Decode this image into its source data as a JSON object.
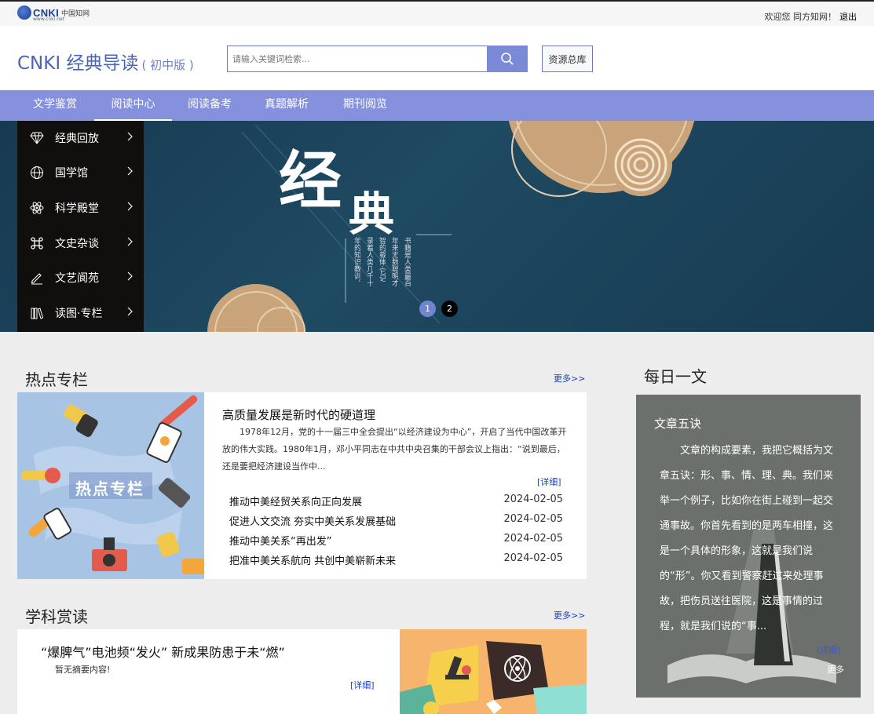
{
  "topbar": {
    "logo_text": "CNKI",
    "logo_cn": "中国知网",
    "logo_url": "www.cnki.net",
    "welcome": "欢迎您 同方知网！",
    "logout": "退出"
  },
  "header": {
    "brand": "CNKI 经典导读",
    "edition": "( 初中版 )",
    "search_placeholder": "请输入关键词检索...",
    "resource_button": "资源总库"
  },
  "nav": {
    "items": [
      "文学鉴赏",
      "阅读中心",
      "阅读备考",
      "真题解析",
      "期刊阅览"
    ],
    "active": "阅读中心"
  },
  "side_menu": {
    "items": [
      {
        "label": "经典回放",
        "icon": "diamond-icon"
      },
      {
        "label": "国学馆",
        "icon": "globe-icon"
      },
      {
        "label": "科学殿堂",
        "icon": "atom-icon"
      },
      {
        "label": "文史杂谈",
        "icon": "command-icon"
      },
      {
        "label": "文艺阆苑",
        "icon": "pen-icon"
      },
      {
        "label": "读图·专栏",
        "icon": "books-icon"
      }
    ],
    "chevron": "›"
  },
  "banner": {
    "title_char_1": "经",
    "title_char_2": "典",
    "poem_lines": [
      "书籍是人类最百",
      "年来无数聪明才",
      "智的载体·它记",
      "录着人类几千十",
      "年的知识教训。"
    ],
    "dots": [
      "1",
      "2"
    ],
    "active_dot": "1"
  },
  "hot": {
    "section_title": "热点专栏",
    "more": "更多>>",
    "image_caption": "热点专栏",
    "title": "高质量发展是新时代的硬道理",
    "summary": "1978年12月，党的十一届三中全会提出“以经济建设为中心”，开启了当代中国改革开放的伟大实践。1980年1月，邓小平同志在中共中央召集的干部会议上指出：“说到最后，还是要把经济建设当作中...",
    "detail": "[详细]",
    "news": [
      {
        "title": "推动中美经贸关系向正向发展",
        "date": "2024-02-05"
      },
      {
        "title": "促进人文交流 夯实中美关系发展基础",
        "date": "2024-02-05"
      },
      {
        "title": "推动中美关系“再出发”",
        "date": "2024-02-05"
      },
      {
        "title": "把准中美关系航向 共创中美崭新未来",
        "date": "2024-02-05"
      }
    ]
  },
  "subject": {
    "section_title": "学科赏读",
    "more": "更多>>",
    "title": "“爆脾气”电池频“发火” 新成果防患于未“燃”",
    "summary": "暂无摘要内容!",
    "detail": "[详细]"
  },
  "daily": {
    "section_title": "每日一文",
    "title": "文章五诀",
    "text": "文章的构成要素，我把它概括为文章五诀：形、事、情、理、典。我们来举一个例子，比如你在街上碰到一起交通事故。你首先看到的是两车相撞，这是一个具体的形象，这就是我们说的“形”。你又看到警察赶过来处理事故，把伤员送往医院，这是事情的过程，就是我们说的“事...",
    "detail": "[详细]",
    "more": "更多"
  },
  "colors": {
    "nav_bg": "#8591dc",
    "brand": "#4a64b8",
    "link": "#1a3fb5",
    "banner_bg": "#1c4258",
    "banner_tan": "#c9a47a",
    "side_menu_bg": "#110e0e"
  }
}
